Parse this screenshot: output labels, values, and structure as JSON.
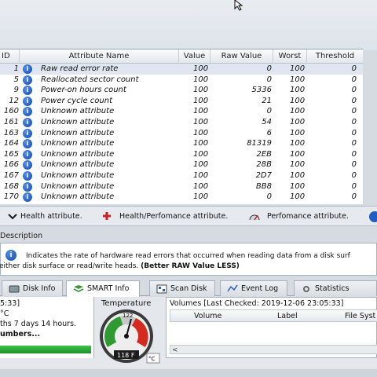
{
  "smart_table": {
    "headers": {
      "id": "ID",
      "attribute_name": "Attribute Name",
      "value": "Value",
      "raw_value": "Raw Value",
      "worst": "Worst",
      "threshold": "Threshold"
    },
    "rows": [
      {
        "id": "1",
        "name": "Raw read error rate",
        "value": "100",
        "raw": "0",
        "worst": "100",
        "threshold": "0"
      },
      {
        "id": "5",
        "name": "Reallocated sector count",
        "value": "100",
        "raw": "0",
        "worst": "100",
        "threshold": "0"
      },
      {
        "id": "9",
        "name": "Power-on hours count",
        "value": "100",
        "raw": "5336",
        "worst": "100",
        "threshold": "0"
      },
      {
        "id": "12",
        "name": "Power cycle count",
        "value": "100",
        "raw": "21",
        "worst": "100",
        "threshold": "0"
      },
      {
        "id": "160",
        "name": "Unknown attribute",
        "value": "100",
        "raw": "0",
        "worst": "100",
        "threshold": "0"
      },
      {
        "id": "161",
        "name": "Unknown attribute",
        "value": "100",
        "raw": "54",
        "worst": "100",
        "threshold": "0"
      },
      {
        "id": "163",
        "name": "Unknown attribute",
        "value": "100",
        "raw": "6",
        "worst": "100",
        "threshold": "0"
      },
      {
        "id": "164",
        "name": "Unknown attribute",
        "value": "100",
        "raw": "81319",
        "worst": "100",
        "threshold": "0"
      },
      {
        "id": "165",
        "name": "Unknown attribute",
        "value": "100",
        "raw": "2EB",
        "worst": "100",
        "threshold": "0"
      },
      {
        "id": "166",
        "name": "Unknown attribute",
        "value": "100",
        "raw": "28B",
        "worst": "100",
        "threshold": "0"
      },
      {
        "id": "167",
        "name": "Unknown attribute",
        "value": "100",
        "raw": "2D7",
        "worst": "100",
        "threshold": "0"
      },
      {
        "id": "168",
        "name": "Unknown attribute",
        "value": "100",
        "raw": "BB8",
        "worst": "100",
        "threshold": "0"
      },
      {
        "id": "170",
        "name": "Unknown attribute",
        "value": "100",
        "raw": "0",
        "worst": "100",
        "threshold": "0"
      }
    ],
    "row_icon": "info-icon",
    "row_icon_glyph": "i",
    "selected_row": 0
  },
  "legend": {
    "health": "Health attribute.",
    "health_perf": "Health/Perfomance attribute.",
    "perf": "Perfomance attribute."
  },
  "description": {
    "title": "Description",
    "icon_glyph": "i",
    "line1": "Indicates the rate of hardware read errors that occurred when reading data from a disk surf",
    "line2_normal": "with either disk surface or read/write heads. ",
    "line2_bold": "(Better RAW Value LESS)"
  },
  "tabs": [
    {
      "label": "Disk Info",
      "icon": "disk-icon"
    },
    {
      "label": "SMART Info",
      "icon": "smart-icon",
      "active": true
    },
    {
      "label": "Scan Disk",
      "icon": "scan-icon"
    },
    {
      "label": "Event Log",
      "icon": "log-icon"
    },
    {
      "label": "Statistics",
      "icon": "stats-icon"
    }
  ],
  "left_info": {
    "line1": "5:33]",
    "line2": "°C",
    "line3": "ths 7 days 14 hours.",
    "line4": "umbers..."
  },
  "temperature": {
    "title": "Temperature",
    "reading": "118 F",
    "dial_label": "122",
    "unit_button": "°C",
    "colors": {
      "green": "#2f9a2f",
      "red": "#d42a1f",
      "gray": "#c8c8c8"
    }
  },
  "volumes": {
    "title": "Volumes [Last Checked: 2019-12-06 23:05:33]",
    "headers": [
      "Volume",
      "Label",
      "File Syst"
    ]
  },
  "colors": {
    "info_icon": "#1f5cc4",
    "progress_green": "#2fae39",
    "selected_row": "#dfe6f1"
  }
}
